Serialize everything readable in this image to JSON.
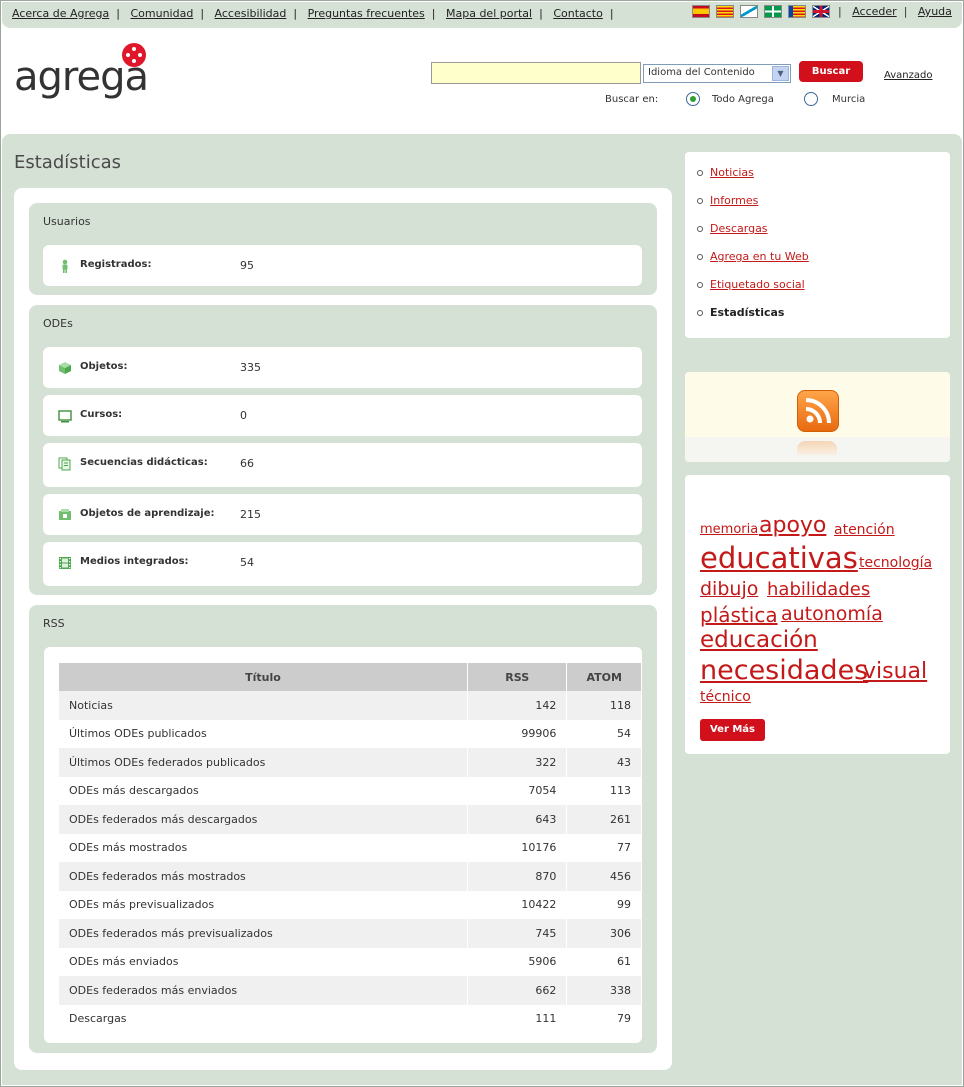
{
  "topnav": {
    "links": [
      "Acerca de Agrega",
      "Comunidad",
      "Accesibilidad",
      "Preguntas frecuentes",
      "Mapa del portal",
      "Contacto"
    ],
    "right_links": [
      "Acceder",
      "Ayuda"
    ],
    "languages": [
      "es",
      "ca",
      "gl",
      "eu",
      "va",
      "en"
    ]
  },
  "header": {
    "logo_text": "agrega",
    "search": {
      "value": "",
      "placeholder": ""
    },
    "language_select": "Idioma del Contenido",
    "search_button": "Buscar",
    "advanced_link": "Avanzado",
    "search_in_label": "Buscar en:",
    "scope_options": [
      {
        "label": "Todo Agrega",
        "selected": true
      },
      {
        "label": "Murcia",
        "selected": false
      }
    ]
  },
  "page": {
    "title": "Estadísticas"
  },
  "usuarios": {
    "title": "Usuarios",
    "rows": [
      {
        "icon": "user-icon",
        "label": "Registrados:",
        "value": "95"
      }
    ]
  },
  "odes": {
    "title": "ODEs",
    "rows": [
      {
        "icon": "cube-icon",
        "label": "Objetos:",
        "value": "335"
      },
      {
        "icon": "monitor-icon",
        "label": "Cursos:",
        "value": "0"
      },
      {
        "icon": "documents-icon",
        "label": "Secuencias didácticas:",
        "value": "66"
      },
      {
        "icon": "learning-object-icon",
        "label": "Objetos de aprendizaje:",
        "value": "215"
      },
      {
        "icon": "film-icon",
        "label": "Medios integrados:",
        "value": "54"
      }
    ]
  },
  "rss": {
    "title": "RSS",
    "columns": [
      "Título",
      "RSS",
      "ATOM"
    ],
    "rows": [
      [
        "Noticias",
        "142",
        "118"
      ],
      [
        "Últimos ODEs publicados",
        "99906",
        "54"
      ],
      [
        "Últimos ODEs federados publicados",
        "322",
        "43"
      ],
      [
        "ODEs más descargados",
        "7054",
        "113"
      ],
      [
        "ODEs federados más descargados",
        "643",
        "261"
      ],
      [
        "ODEs más mostrados",
        "10176",
        "77"
      ],
      [
        "ODEs federados más mostrados",
        "870",
        "456"
      ],
      [
        "ODEs más previsualizados",
        "10422",
        "99"
      ],
      [
        "ODEs federados más previsualizados",
        "745",
        "306"
      ],
      [
        "ODEs más enviados",
        "5906",
        "61"
      ],
      [
        "ODEs federados más enviados",
        "662",
        "338"
      ],
      [
        "Descargas",
        "111",
        "79"
      ]
    ]
  },
  "sidebar": {
    "items": [
      {
        "label": "Noticias",
        "current": false
      },
      {
        "label": "Informes",
        "current": false
      },
      {
        "label": "Descargas",
        "current": false
      },
      {
        "label": "Agrega en tu Web",
        "current": false
      },
      {
        "label": "Etiquetado social",
        "current": false
      },
      {
        "label": "Estadísticas",
        "current": true
      }
    ],
    "rss_icon": "rss-feed-icon"
  },
  "tag_cloud": {
    "tags": [
      "memoria",
      "apoyo",
      "atención",
      "educativas",
      "tecnología",
      "dibujo",
      "habilidades",
      "plástica",
      "autonomía",
      "educación",
      "necesidades",
      "visual",
      "técnico"
    ],
    "more_button": "Ver Más"
  },
  "colors": {
    "accent": "#d2101c",
    "link": "#c41919",
    "panel": "#d6e1d6"
  }
}
